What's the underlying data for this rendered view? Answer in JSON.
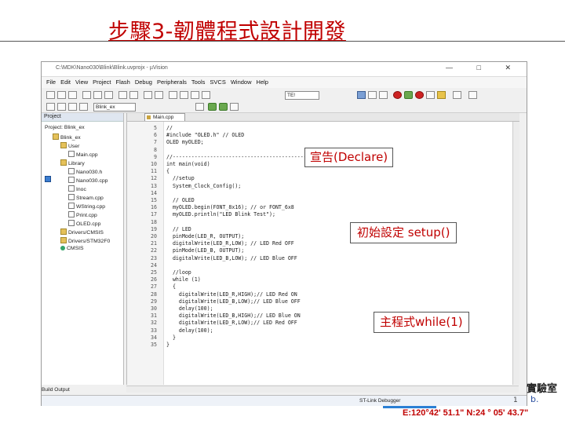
{
  "slide": {
    "title": "步驟3-韌體程式設計開發",
    "lab_name": "實驗室",
    "lab_sub": "b.",
    "page_no": "1",
    "coordinates": "E:120°42' 51.1\"  N:24 ° 05' 43.7\""
  },
  "ide": {
    "window_title": "C:\\MDK\\Nano030\\Blink\\Blink.uvprojx - µVision",
    "window_buttons": "— □ ✕",
    "menu": [
      "File",
      "Edit",
      "View",
      "Project",
      "Flash",
      "Debug",
      "Peripherals",
      "Tools",
      "SVCS",
      "Window",
      "Help"
    ],
    "target_combo": "Blink_ex",
    "find_combo": "TE!",
    "project_panel_title": "Project: Blink_ex",
    "editor_tab": "Main.cpp",
    "build_output_label": "Build Output",
    "status_debugger": "ST-Link Debugger",
    "tree": [
      {
        "label": "Project: Blink_ex",
        "icon": "proj",
        "level": 0
      },
      {
        "label": "Blink_ex",
        "icon": "folder",
        "level": 1
      },
      {
        "label": "User",
        "icon": "folder",
        "level": 2
      },
      {
        "label": "Main.cpp",
        "icon": "file",
        "level": 3
      },
      {
        "label": "Library",
        "icon": "folder",
        "level": 2
      },
      {
        "label": "Nano030.h",
        "icon": "file",
        "level": 3
      },
      {
        "label": "Nano030.cpp",
        "icon": "file",
        "level": 3
      },
      {
        "label": "Inoc",
        "icon": "file",
        "level": 3
      },
      {
        "label": "Stream.cpp",
        "icon": "file",
        "level": 3
      },
      {
        "label": "WString.cpp",
        "icon": "file",
        "level": 3
      },
      {
        "label": "Print.cpp",
        "icon": "file",
        "level": 3
      },
      {
        "label": "OLED.cpp",
        "icon": "file",
        "level": 3
      },
      {
        "label": "Drivers/CMSIS",
        "icon": "folder",
        "level": 2
      },
      {
        "label": "Drivers/STM32F0",
        "icon": "folder",
        "level": 2
      },
      {
        "label": "CMSIS",
        "icon": "gem",
        "level": 2
      }
    ],
    "code": [
      {
        "n": "5",
        "t": "//"
      },
      {
        "n": "6",
        "t": "#include \"OLED.h\" // OLED"
      },
      {
        "n": "7",
        "t": "OLED myOLED;"
      },
      {
        "n": "8",
        "t": ""
      },
      {
        "n": "9",
        "t": "//-----------------------------------------------------------------"
      },
      {
        "n": "10",
        "t": "int main(void)"
      },
      {
        "n": "11",
        "t": "{"
      },
      {
        "n": "12",
        "t": "  //setup"
      },
      {
        "n": "13",
        "t": "  System_Clock_Config();"
      },
      {
        "n": "14",
        "t": ""
      },
      {
        "n": "15",
        "t": "  // OLED"
      },
      {
        "n": "16",
        "t": "  myOLED.begin(FONT_8x16); // or FONT_6x8"
      },
      {
        "n": "17",
        "t": "  myOLED.println(\"LED Blink Test\");"
      },
      {
        "n": "18",
        "t": ""
      },
      {
        "n": "19",
        "t": "  // LED"
      },
      {
        "n": "20",
        "t": "  pinMode(LED_R, OUTPUT);"
      },
      {
        "n": "21",
        "t": "  digitalWrite(LED_R,LOW); // LED Red OFF"
      },
      {
        "n": "22",
        "t": "  pinMode(LED_B, OUTPUT);"
      },
      {
        "n": "23",
        "t": "  digitalWrite(LED_B,LOW); // LED Blue OFF"
      },
      {
        "n": "24",
        "t": ""
      },
      {
        "n": "25",
        "t": "  //loop"
      },
      {
        "n": "26",
        "t": "  while (1)"
      },
      {
        "n": "27",
        "t": "  {"
      },
      {
        "n": "28",
        "t": "    digitalWrite(LED_R,HIGH);// LED Red ON"
      },
      {
        "n": "29",
        "t": "    digitalWrite(LED_B,LOW);// LED Blue OFF"
      },
      {
        "n": "30",
        "t": "    delay(100);"
      },
      {
        "n": "31",
        "t": "    digitalWrite(LED_B,HIGH);// LED Blue ON"
      },
      {
        "n": "32",
        "t": "    digitalWrite(LED_R,LOW);// LED Red OFF"
      },
      {
        "n": "33",
        "t": "    delay(100);"
      },
      {
        "n": "34",
        "t": "  }"
      },
      {
        "n": "35",
        "t": "}"
      }
    ]
  },
  "callouts": {
    "declare": "宣告(Declare)",
    "setup": "初始設定 setup()",
    "loop": "主程式while(1)"
  }
}
